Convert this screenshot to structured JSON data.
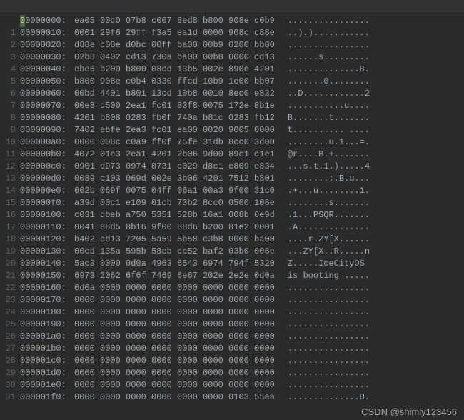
{
  "watermark": "CSDN @shimly123456",
  "rows": [
    {
      "ln": "",
      "offset": "00000000:",
      "hex": "ea05 00c0 07b8 c007 8ed8 b800 908e c0b9",
      "ascii": "................"
    },
    {
      "ln": "1",
      "offset": "00000010:",
      "hex": "0001 29f6 29ff f3a5 ea1d 0000 908c c88e",
      "ascii": "..).)..........."
    },
    {
      "ln": "2",
      "offset": "00000020:",
      "hex": "d88e c08e d0bc 00ff ba00 00b9 0200 bb00",
      "ascii": "................"
    },
    {
      "ln": "3",
      "offset": "00000030:",
      "hex": "02b8 0402 cd13 730a ba00 00b8 0000 cd13",
      "ascii": "......s........."
    },
    {
      "ln": "4",
      "offset": "00000040:",
      "hex": "ebe6 b200 b800 08cd 13b5 002e 890e 4201",
      "ascii": "..............B."
    },
    {
      "ln": "5",
      "offset": "00000050:",
      "hex": "b800 908e c0b4 0330 ffcd 10b9 1e00 bb07",
      "ascii": ".......0........"
    },
    {
      "ln": "6",
      "offset": "00000060:",
      "hex": "00bd 4401 b801 13cd 10b8 0010 8ec0 e832",
      "ascii": "..D............2"
    },
    {
      "ln": "7",
      "offset": "00000070:",
      "hex": "00e8 c500 2ea1 fc01 83f8 0075 172e 8b1e",
      "ascii": "...........u...."
    },
    {
      "ln": "8",
      "offset": "00000080:",
      "hex": "4201 b808 0283 fb0f 740a b81c 0283 fb12",
      "ascii": "B.......t......."
    },
    {
      "ln": "9",
      "offset": "00000090:",
      "hex": "7402 ebfe 2ea3 fc01 ea00 0020 9005 0000",
      "ascii": "t.......... ...."
    },
    {
      "ln": "10",
      "offset": "000000a0:",
      "hex": "0000 008c c0a9 ff0f 75fe 31db 8cc0 3d00",
      "ascii": "........u.1...=."
    },
    {
      "ln": "11",
      "offset": "000000b0:",
      "hex": "4072 01c3 2ea1 4201 2b06 9d00 89c1 c1e1",
      "ascii": "@r....B.+......."
    },
    {
      "ln": "12",
      "offset": "000000c0:",
      "hex": "0901 d973 0974 0731 c029 d8c1 e809 e834",
      "ascii": "...s.t.1.).....4"
    },
    {
      "ln": "13",
      "offset": "000000d0:",
      "hex": "0089 c103 069d 002e 3b06 4201 7512 b801",
      "ascii": "........;.B.u..."
    },
    {
      "ln": "14",
      "offset": "000000e0:",
      "hex": "002b 069f 0075 04ff 06a1 00a3 9f00 31c0",
      "ascii": ".+...u........1."
    },
    {
      "ln": "15",
      "offset": "000000f0:",
      "hex": "a39d 00c1 e109 01cb 73b2 8cc0 0500 108e",
      "ascii": "........s......."
    },
    {
      "ln": "16",
      "offset": "00000100:",
      "hex": "c031 dbeb a750 5351 528b 16a1 008b 0e9d",
      "ascii": ".1...PSQR......."
    },
    {
      "ln": "17",
      "offset": "00000110:",
      "hex": "0041 88d5 8b16 9f00 88d6 b200 81e2 0001",
      "ascii": ".A.............."
    },
    {
      "ln": "18",
      "offset": "00000120:",
      "hex": "b402 cd13 7205 5a59 5b58 c3b8 0000 ba00",
      "ascii": "....r.ZY[X......"
    },
    {
      "ln": "19",
      "offset": "00000130:",
      "hex": "00cd 135a 595b 58eb cc52 baf2 03b0 006e",
      "ascii": "...ZY[X..R.....n"
    },
    {
      "ln": "20",
      "offset": "00000140:",
      "hex": "5ac3 0000 0d0a 4963 6543 6974 794f 5320",
      "ascii": "Z.....IceCityOS "
    },
    {
      "ln": "21",
      "offset": "00000150:",
      "hex": "6973 2062 6f6f 7469 6e67 202e 2e2e 0d0a",
      "ascii": "is booting ....."
    },
    {
      "ln": "22",
      "offset": "00000160:",
      "hex": "0d0a 0000 0000 0000 0000 0000 0000 0000",
      "ascii": "................"
    },
    {
      "ln": "23",
      "offset": "00000170:",
      "hex": "0000 0000 0000 0000 0000 0000 0000 0000",
      "ascii": "................"
    },
    {
      "ln": "24",
      "offset": "00000180:",
      "hex": "0000 0000 0000 0000 0000 0000 0000 0000",
      "ascii": "................"
    },
    {
      "ln": "25",
      "offset": "00000190:",
      "hex": "0000 0000 0000 0000 0000 0000 0000 0000",
      "ascii": "................"
    },
    {
      "ln": "26",
      "offset": "000001a0:",
      "hex": "0000 0000 0000 0000 0000 0000 0000 0000",
      "ascii": "................"
    },
    {
      "ln": "27",
      "offset": "000001b0:",
      "hex": "0000 0000 0000 0000 0000 0000 0000 0000",
      "ascii": "................"
    },
    {
      "ln": "28",
      "offset": "000001c0:",
      "hex": "0000 0000 0000 0000 0000 0000 0000 0000",
      "ascii": "................"
    },
    {
      "ln": "29",
      "offset": "000001d0:",
      "hex": "0000 0000 0000 0000 0000 0000 0000 0000",
      "ascii": "................"
    },
    {
      "ln": "30",
      "offset": "000001e0:",
      "hex": "0000 0000 0000 0000 0000 0000 0000 0000",
      "ascii": "................"
    },
    {
      "ln": "31",
      "offset": "000001f0:",
      "hex": "0000 0000 0000 0000 0000 0000 0103 55aa",
      "ascii": "..............U."
    }
  ]
}
